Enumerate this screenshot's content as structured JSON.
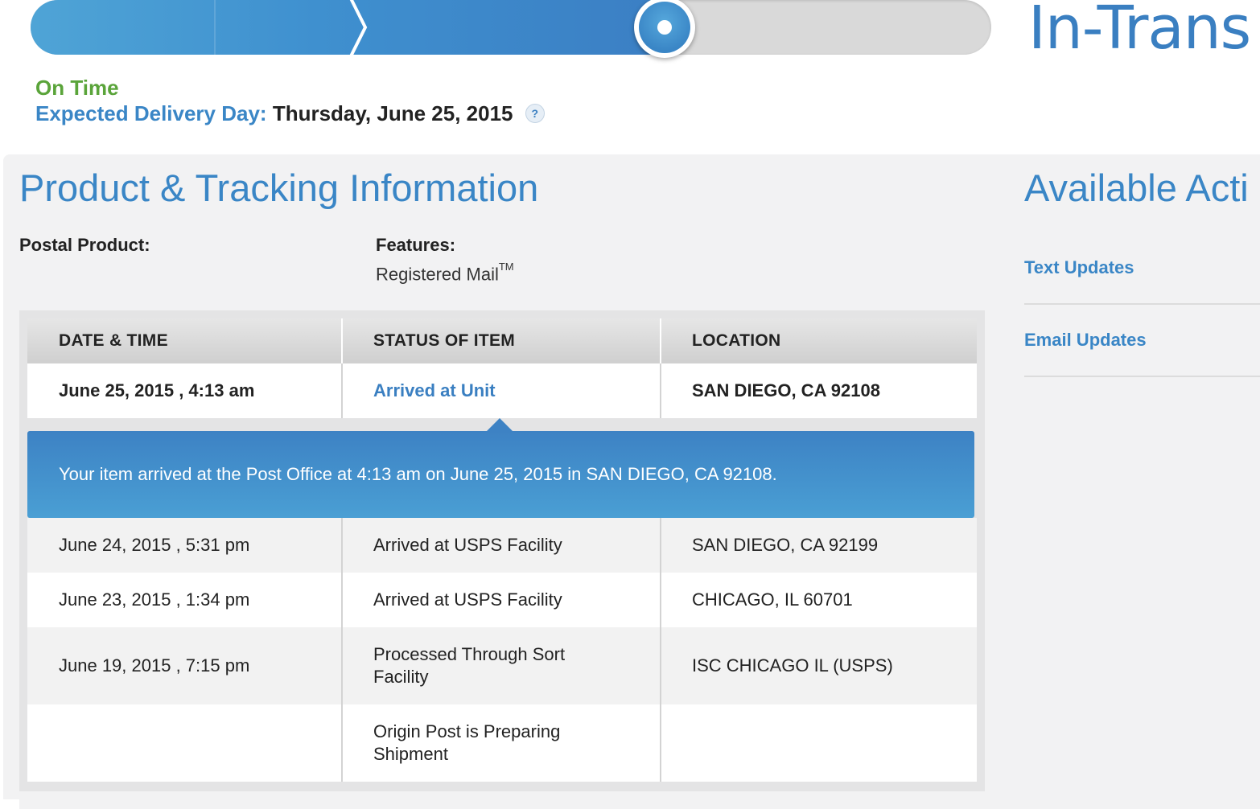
{
  "progress": {
    "status_heading": "In-Trans",
    "fill_fraction": 0.66
  },
  "delivery": {
    "on_time": "On Time",
    "expected_label": "Expected Delivery Day:",
    "expected_value": "Thursday, June 25, 2015",
    "help_icon": "?"
  },
  "product": {
    "title": "Product & Tracking Information",
    "postal_product_label": "Postal Product:",
    "features_label": "Features:",
    "features_value": "Registered Mail",
    "trademark": "TM"
  },
  "actions": {
    "title": "Available Acti",
    "items": [
      {
        "label": "Text Updates"
      },
      {
        "label": "Email Updates"
      }
    ]
  },
  "table": {
    "headers": [
      "DATE & TIME",
      "STATUS OF ITEM",
      "LOCATION"
    ],
    "latest": {
      "datetime": "June 25, 2015 , 4:13 am",
      "status": "Arrived at Unit",
      "location": "SAN DIEGO, CA 92108",
      "detail": "Your item arrived at the Post Office at 4:13 am on June 25, 2015 in SAN DIEGO, CA 92108."
    },
    "rows": [
      {
        "datetime": "June 24, 2015 , 5:31 pm",
        "status": "Arrived at USPS Facility",
        "location": "SAN DIEGO, CA 92199"
      },
      {
        "datetime": "June 23, 2015 , 1:34 pm",
        "status": "Arrived at USPS Facility",
        "location": "CHICAGO, IL 60701"
      },
      {
        "datetime": "June 19, 2015 , 7:15 pm",
        "status": "Processed Through Sort Facility",
        "location": "ISC CHICAGO IL (USPS)"
      },
      {
        "datetime": "",
        "status": "Origin Post is Preparing Shipment",
        "location": ""
      }
    ]
  },
  "colors": {
    "brand_blue": "#3a86c6",
    "on_time_green": "#5aa43a",
    "panel_bg": "#f2f2f3"
  }
}
